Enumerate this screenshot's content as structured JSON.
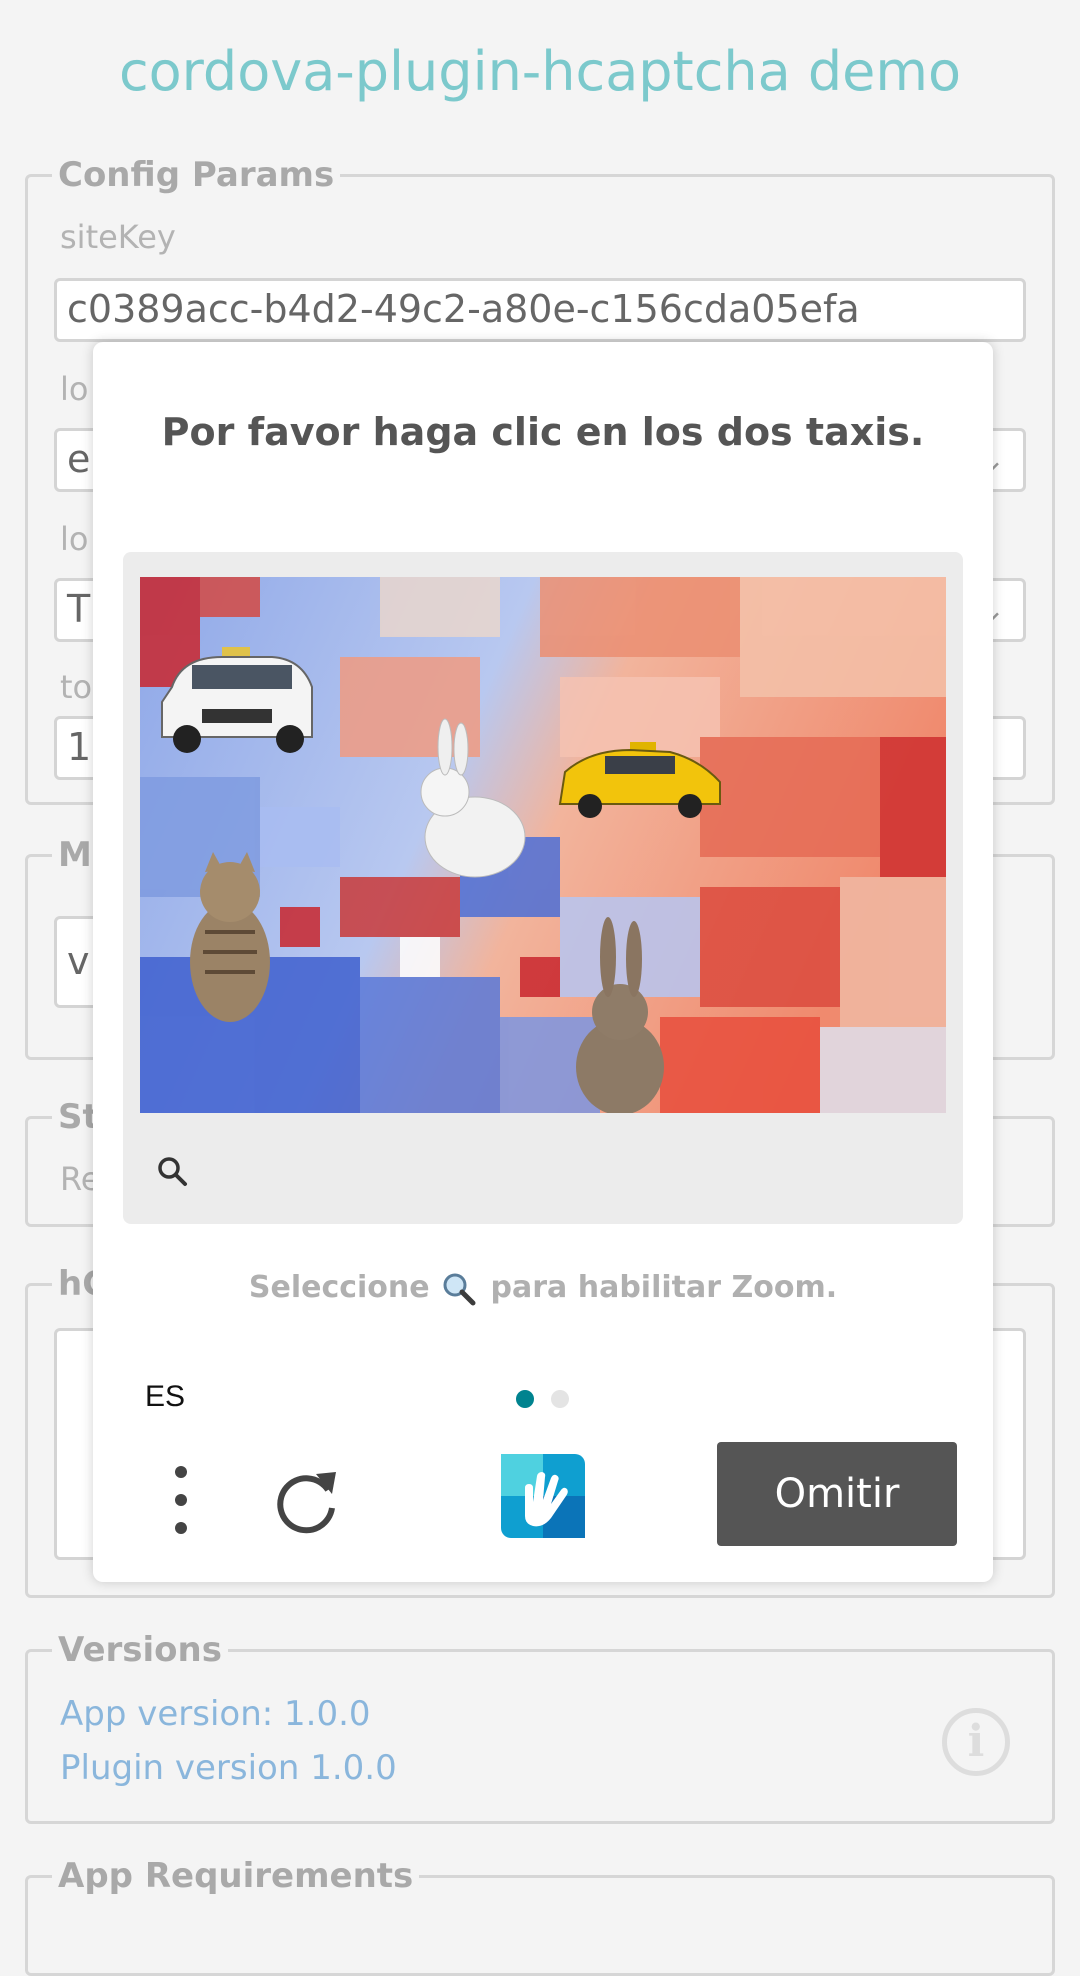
{
  "app": {
    "title": "cordova-plugin-hcaptcha demo"
  },
  "config": {
    "legend": "Config Params",
    "sitekey_label": "siteKey",
    "sitekey_value": "c0389acc-b4d2-49c2-a80e-c156cda05efa",
    "partial": {
      "row2_label": "lo",
      "row2_value": "e",
      "row3_label": "lo",
      "row3_value": "T",
      "row4_label": "to",
      "row4_value": "1"
    }
  },
  "section_m": {
    "legend_partial": "M",
    "value_partial": "v"
  },
  "section_s": {
    "legend_partial": "St",
    "value_partial": "Re"
  },
  "section_h": {
    "legend_partial": "hC"
  },
  "versions": {
    "legend": "Versions",
    "app_version": "App version: 1.0.0",
    "plugin_version": "Plugin version 1.0.0",
    "info_icon": "info-icon"
  },
  "requirements": {
    "legend": "App Requirements"
  },
  "captcha": {
    "prompt": "Por favor haga clic en los dos taxis.",
    "hint_before": "Seleccione",
    "hint_after": "para habilitar Zoom.",
    "language": "ES",
    "skip_label": "Omitir",
    "accent": "#00838f",
    "page_dots": {
      "active": 1,
      "total": 2
    },
    "icons": [
      "zoom-icon",
      "menu-icon",
      "refresh-icon",
      "hcaptcha-logo"
    ],
    "image_objects": [
      "white taxi car",
      "white rabbit",
      "yellow taxi",
      "tabby cat",
      "brown rabbit"
    ]
  }
}
